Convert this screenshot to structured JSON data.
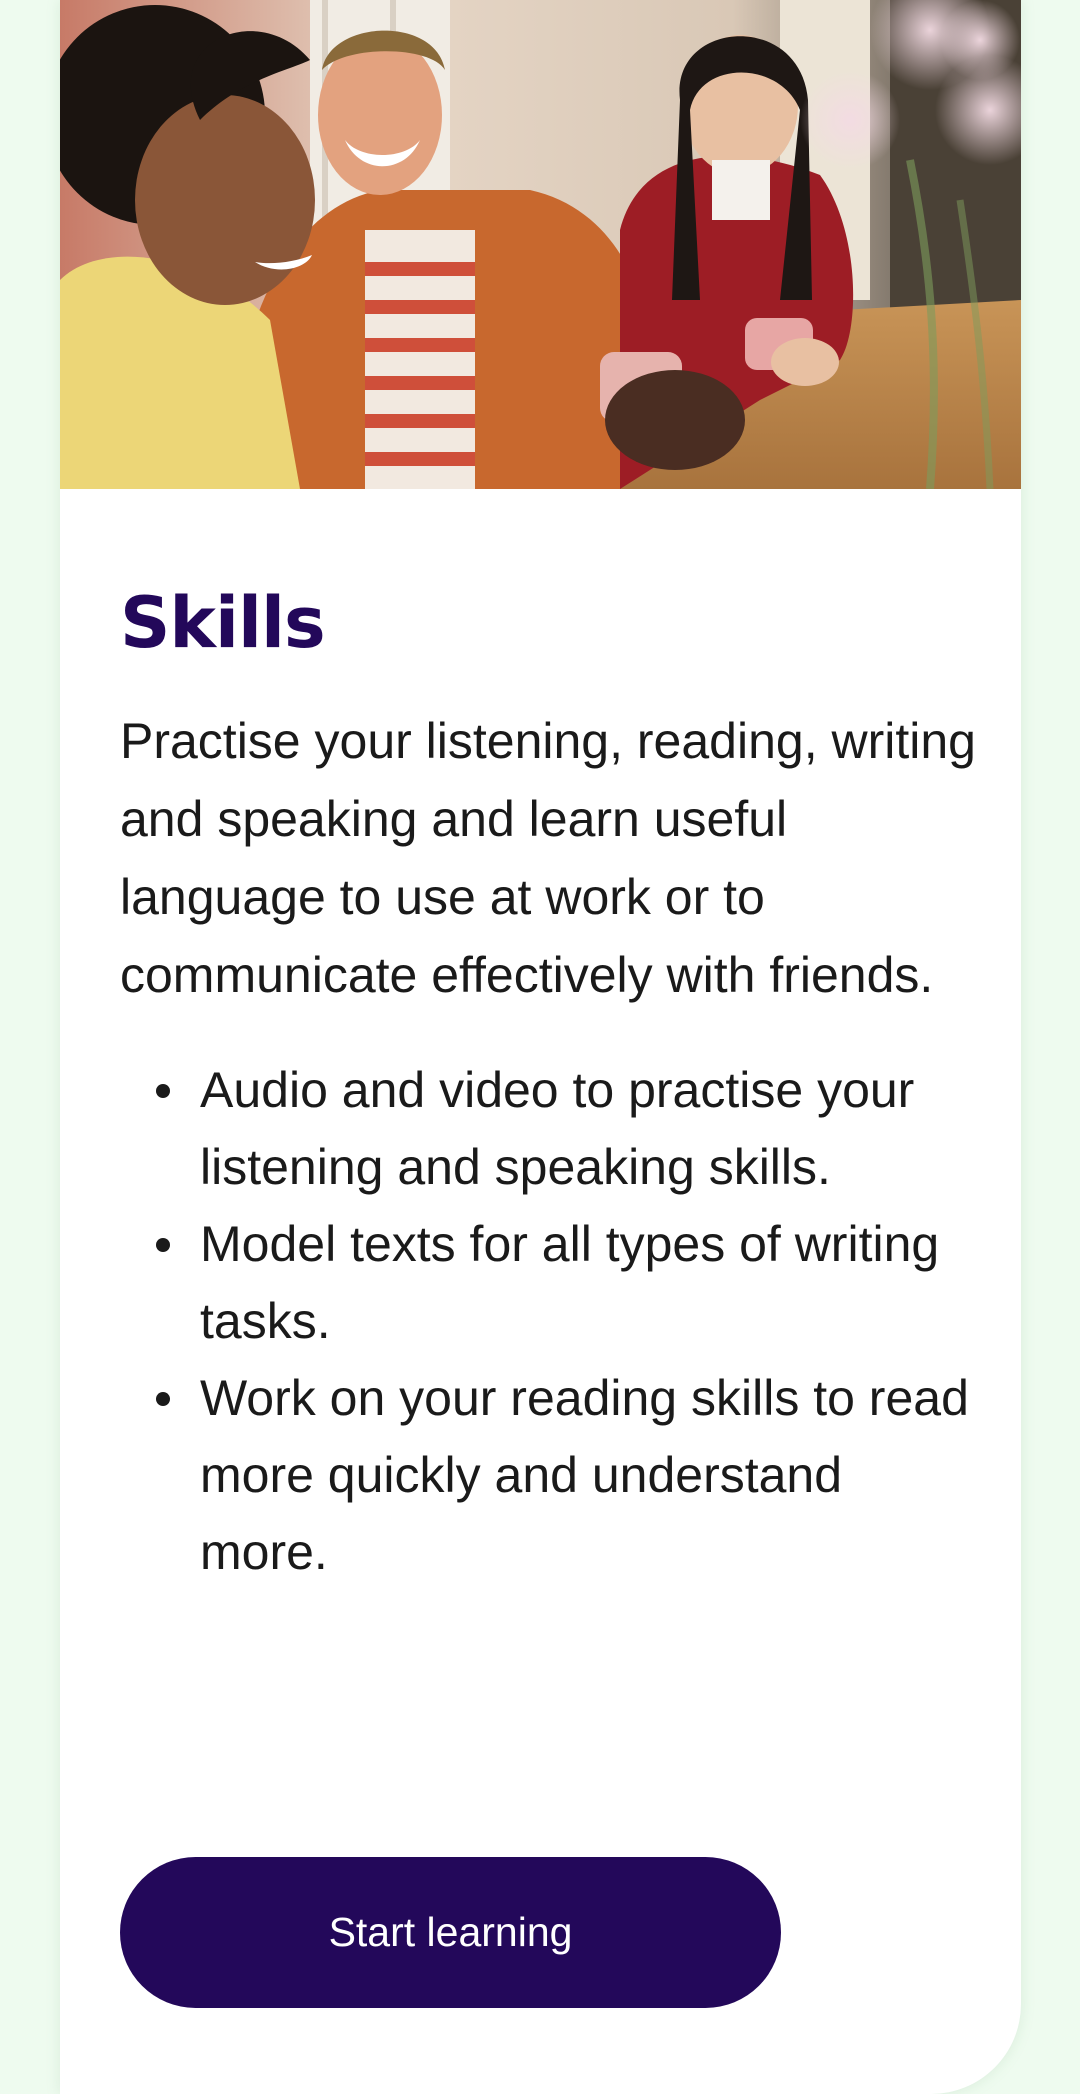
{
  "hero": {
    "image_icon": "photo-friends-at-cafe-table"
  },
  "skills_card": {
    "title": "Skills",
    "intro": "Practise your listening, reading, writing and speaking and learn useful language to use at work or to communicate effectively with friends.",
    "bullets": [
      "Audio and video to practise your listening and speaking skills.",
      "Model texts for all types of writing tasks.",
      "Work on your reading skills to read more quickly and understand more."
    ],
    "cta_label": "Start learning"
  },
  "colors": {
    "page_background": "#eefbef",
    "title": "#23085a",
    "button": "#23085a",
    "button_text": "#ffffff",
    "body_text": "#1a1a1a"
  }
}
